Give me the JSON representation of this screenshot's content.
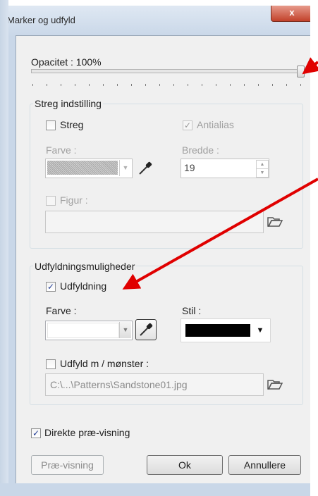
{
  "window": {
    "title": "Marker og udfyld",
    "close_glyph": "x"
  },
  "opacity": {
    "label": "Opacitet : 100%",
    "value": 100
  },
  "stroke_group": {
    "legend": "Streg indstilling",
    "streg_label": "Streg",
    "streg_checked": false,
    "antialias_label": "Antialias",
    "antialias_checked": true,
    "color_label": "Farve :",
    "width_label": "Bredde :",
    "width_value": "19",
    "figure_label": "Figur :",
    "figure_value": ""
  },
  "fill_group": {
    "legend": "Udfyldningsmuligheder",
    "fill_label": "Udfyldning",
    "fill_checked": true,
    "color_label": "Farve :",
    "style_label": "Stil :",
    "pattern_label": "Udfyld m / mønster :",
    "pattern_checked": false,
    "pattern_path": "C:\\...\\Patterns\\Sandstone01.jpg"
  },
  "preview": {
    "direct_label": "Direkte præ-visning",
    "direct_checked": true
  },
  "buttons": {
    "preview": "Præ-visning",
    "ok": "Ok",
    "cancel": "Annullere"
  },
  "colors": {
    "annotation_arrow": "#e00000",
    "style_swatch": "#000000",
    "window_chrome": "#c9d7e8"
  },
  "icons": [
    "eyedropper-icon",
    "folder-open-icon",
    "dropdown-arrow-icon",
    "spin-up-icon",
    "spin-down-icon",
    "close-icon",
    "checkmark-icon"
  ]
}
